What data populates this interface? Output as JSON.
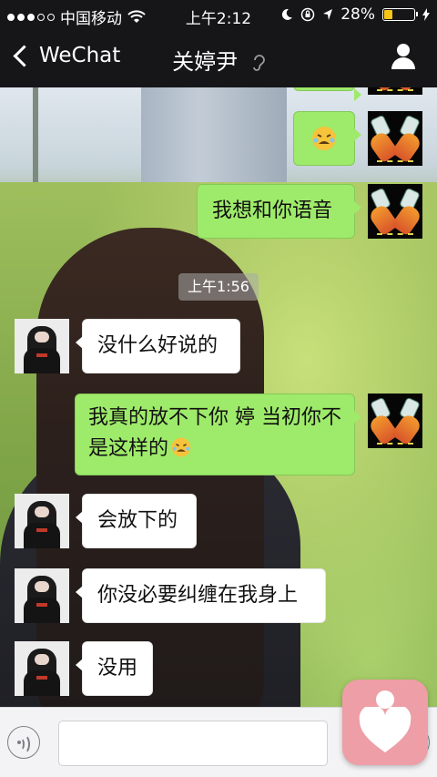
{
  "status_bar": {
    "carrier": "中国移动",
    "time": "上午2:12",
    "battery_percent": "28%",
    "battery_level": 0.28,
    "signal_bars_filled": 3,
    "signal_bars_total": 5
  },
  "nav": {
    "back_label": "WeChat",
    "title": "关婷尹",
    "icons": [
      "back-chevron-icon",
      "earpiece-icon",
      "profile-icon"
    ]
  },
  "messages": [
    {
      "sender": "me",
      "text": "我想和你语音"
    },
    {
      "sender": "timestamp",
      "text": "上午1:56"
    },
    {
      "sender": "other",
      "text": "没什么好说的"
    },
    {
      "sender": "me",
      "text": "我真的放不下你 婷 当初你不是这样的"
    },
    {
      "sender": "other",
      "text": "会放下的"
    },
    {
      "sender": "other",
      "text": "你没必要纠缠在我身上"
    },
    {
      "sender": "other",
      "text": "没用"
    }
  ],
  "input_bar": {
    "icons": [
      "voice-icon",
      "plus-icon"
    ]
  },
  "colors": {
    "bar_dark": "#161618",
    "bubble_green": "#9eea6a",
    "bubble_white": "#ffffff",
    "float_button": "#ee9ea6",
    "battery_fill": "#f5c518"
  }
}
